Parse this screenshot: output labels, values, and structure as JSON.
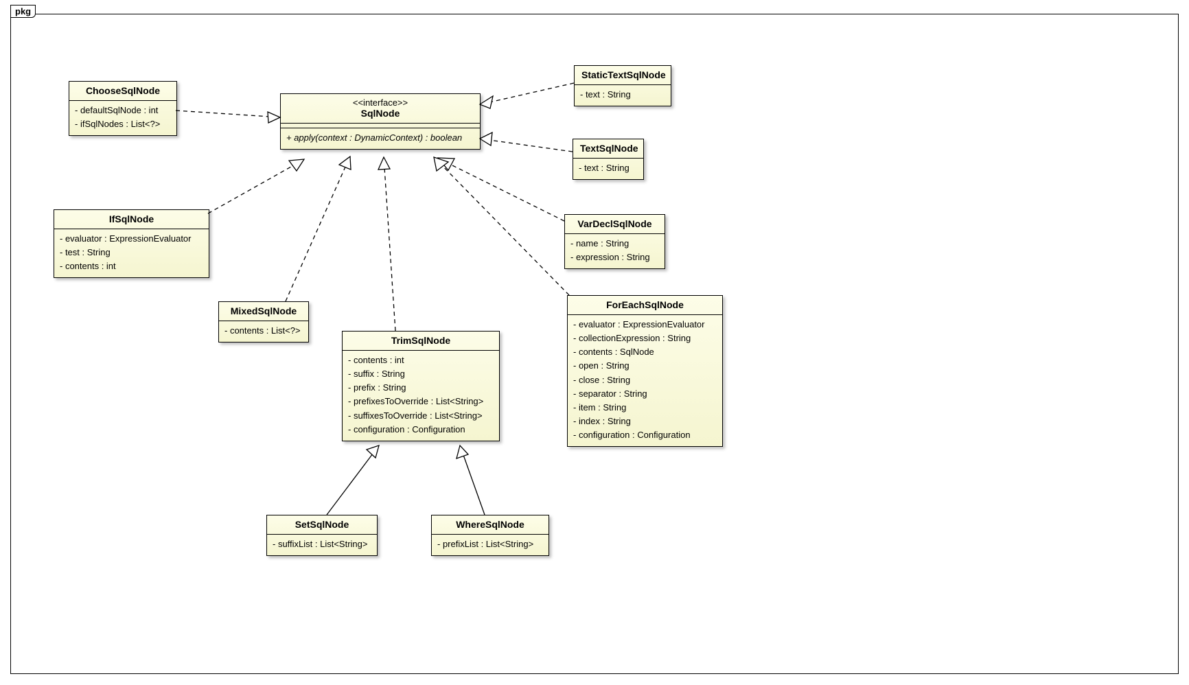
{
  "packageLabel": "pkg",
  "interface": {
    "stereotype": "<<interface>>",
    "name": "SqlNode",
    "method": "+ apply(context : DynamicContext) : boolean"
  },
  "classes": {
    "ChooseSqlNode": {
      "name": "ChooseSqlNode",
      "attrs": [
        "- defaultSqlNode : int",
        "- ifSqlNodes : List<?>"
      ]
    },
    "StaticTextSqlNode": {
      "name": "StaticTextSqlNode",
      "attrs": [
        "- text : String"
      ]
    },
    "TextSqlNode": {
      "name": "TextSqlNode",
      "attrs": [
        "- text : String"
      ]
    },
    "IfSqlNode": {
      "name": "IfSqlNode",
      "attrs": [
        "- evaluator : ExpressionEvaluator",
        "- test : String",
        "- contents : int"
      ]
    },
    "VarDeclSqlNode": {
      "name": "VarDeclSqlNode",
      "attrs": [
        "- name : String",
        "- expression : String"
      ]
    },
    "MixedSqlNode": {
      "name": "MixedSqlNode",
      "attrs": [
        "- contents : List<?>"
      ]
    },
    "TrimSqlNode": {
      "name": "TrimSqlNode",
      "attrs": [
        "- contents : int",
        "- suffix : String",
        "- prefix : String",
        "- prefixesToOverride : List<String>",
        "- suffixesToOverride : List<String>",
        "- configuration : Configuration"
      ]
    },
    "ForEachSqlNode": {
      "name": "ForEachSqlNode",
      "attrs": [
        "- evaluator : ExpressionEvaluator",
        "- collectionExpression : String",
        "- contents : SqlNode",
        "- open : String",
        "- close : String",
        "- separator : String",
        "- item : String",
        "- index : String",
        "- configuration : Configuration"
      ]
    },
    "SetSqlNode": {
      "name": "SetSqlNode",
      "attrs": [
        "- suffixList : List<String>"
      ]
    },
    "WhereSqlNode": {
      "name": "WhereSqlNode",
      "attrs": [
        "- prefixList : List<String>"
      ]
    }
  }
}
